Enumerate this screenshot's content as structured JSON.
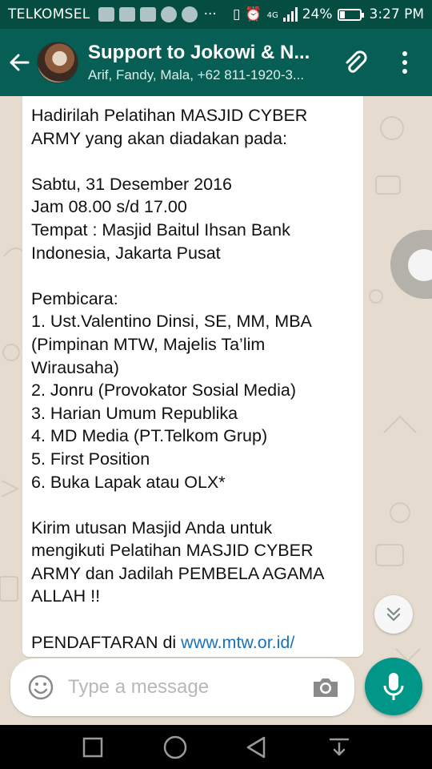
{
  "status_bar": {
    "carrier": "TELKOMSEL",
    "more_indicator": "···",
    "network_type": "4G",
    "battery_percent": "24%",
    "battery_level": 0.24,
    "time": "3:27 PM"
  },
  "app_bar": {
    "title": "Support to Jokowi & N...",
    "subtitle": "Arif, Fandy, Mala, +62 811-1920-3..."
  },
  "message": {
    "lines": [
      "Hadirilah Pelatihan MASJID CYBER",
      "ARMY yang akan diadakan pada:",
      "",
      "Sabtu, 31 Desember 2016",
      "Jam 08.00 s/d 17.00",
      "Tempat : Masjid Baitul Ihsan Bank",
      "Indonesia, Jakarta Pusat",
      "",
      "Pembicara:",
      "1. Ust.Valentino Dinsi, SE, MM, MBA",
      "(Pimpinan MTW, Majelis Ta’lim",
      "Wirausaha)",
      "2. Jonru (Provokator Sosial Media)",
      "3. Harian Umum Republika",
      "4. MD Media (PT.Telkom Grup)",
      "5. First Position",
      "6. Buka Lapak atau OLX*",
      "",
      "Kirim utusan Masjid Anda untuk",
      "mengikuti Pelatihan MASJID CYBER",
      "ARMY dan Jadilah PEMBELA AGAMA",
      "ALLAH !!",
      ""
    ],
    "last_line_prefix": "PENDAFTARAN di ",
    "last_line_link": "www.mtw.or.id/"
  },
  "input": {
    "placeholder": "Type a message"
  },
  "icons": {
    "back": "back-arrow-icon",
    "attach": "paperclip-icon",
    "menu": "more-vert-icon",
    "emoji": "emoji-icon",
    "camera": "camera-icon",
    "mic": "mic-icon",
    "scroll_down": "chevron-double-down-icon",
    "nav": [
      "recent-apps-icon",
      "home-icon",
      "back-icon",
      "notifications-icon"
    ]
  },
  "colors": {
    "header": "#075e54",
    "status_bar": "#044d40",
    "accent": "#009688",
    "link": "#1b72b9",
    "chat_background": "#e5dccf"
  }
}
